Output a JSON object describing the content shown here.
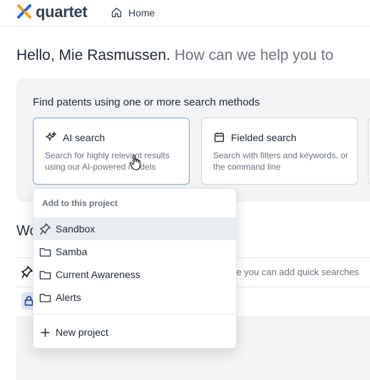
{
  "brand": {
    "name": "quartet"
  },
  "nav": {
    "home_label": "Home"
  },
  "greeting": {
    "name_part": "Hello, Mie Rasmussen.",
    "question_part": "How can we help you to"
  },
  "search": {
    "title": "Find patents using one or more search methods",
    "cards": [
      {
        "title": "AI search",
        "description": "Search for highly relevant results using our AI-powered models"
      },
      {
        "title": "Fielded search",
        "description": "Search with filters and keywords, or the command line"
      }
    ]
  },
  "workspace": {
    "heading_visible": "Wo",
    "row_text": "ere you can add quick searches"
  },
  "dropdown": {
    "header": "Add to this project",
    "items": [
      {
        "label": "Sandbox",
        "icon": "pin-icon"
      },
      {
        "label": "Samba",
        "icon": "folder-icon"
      },
      {
        "label": "Current Awareness",
        "icon": "folder-icon"
      },
      {
        "label": "Alerts",
        "icon": "folder-icon"
      }
    ],
    "new_project_label": "New project"
  },
  "colors": {
    "accent": "#7aa3d6",
    "logo_orange": "#f59e0b",
    "logo_blue": "#2563eb"
  }
}
